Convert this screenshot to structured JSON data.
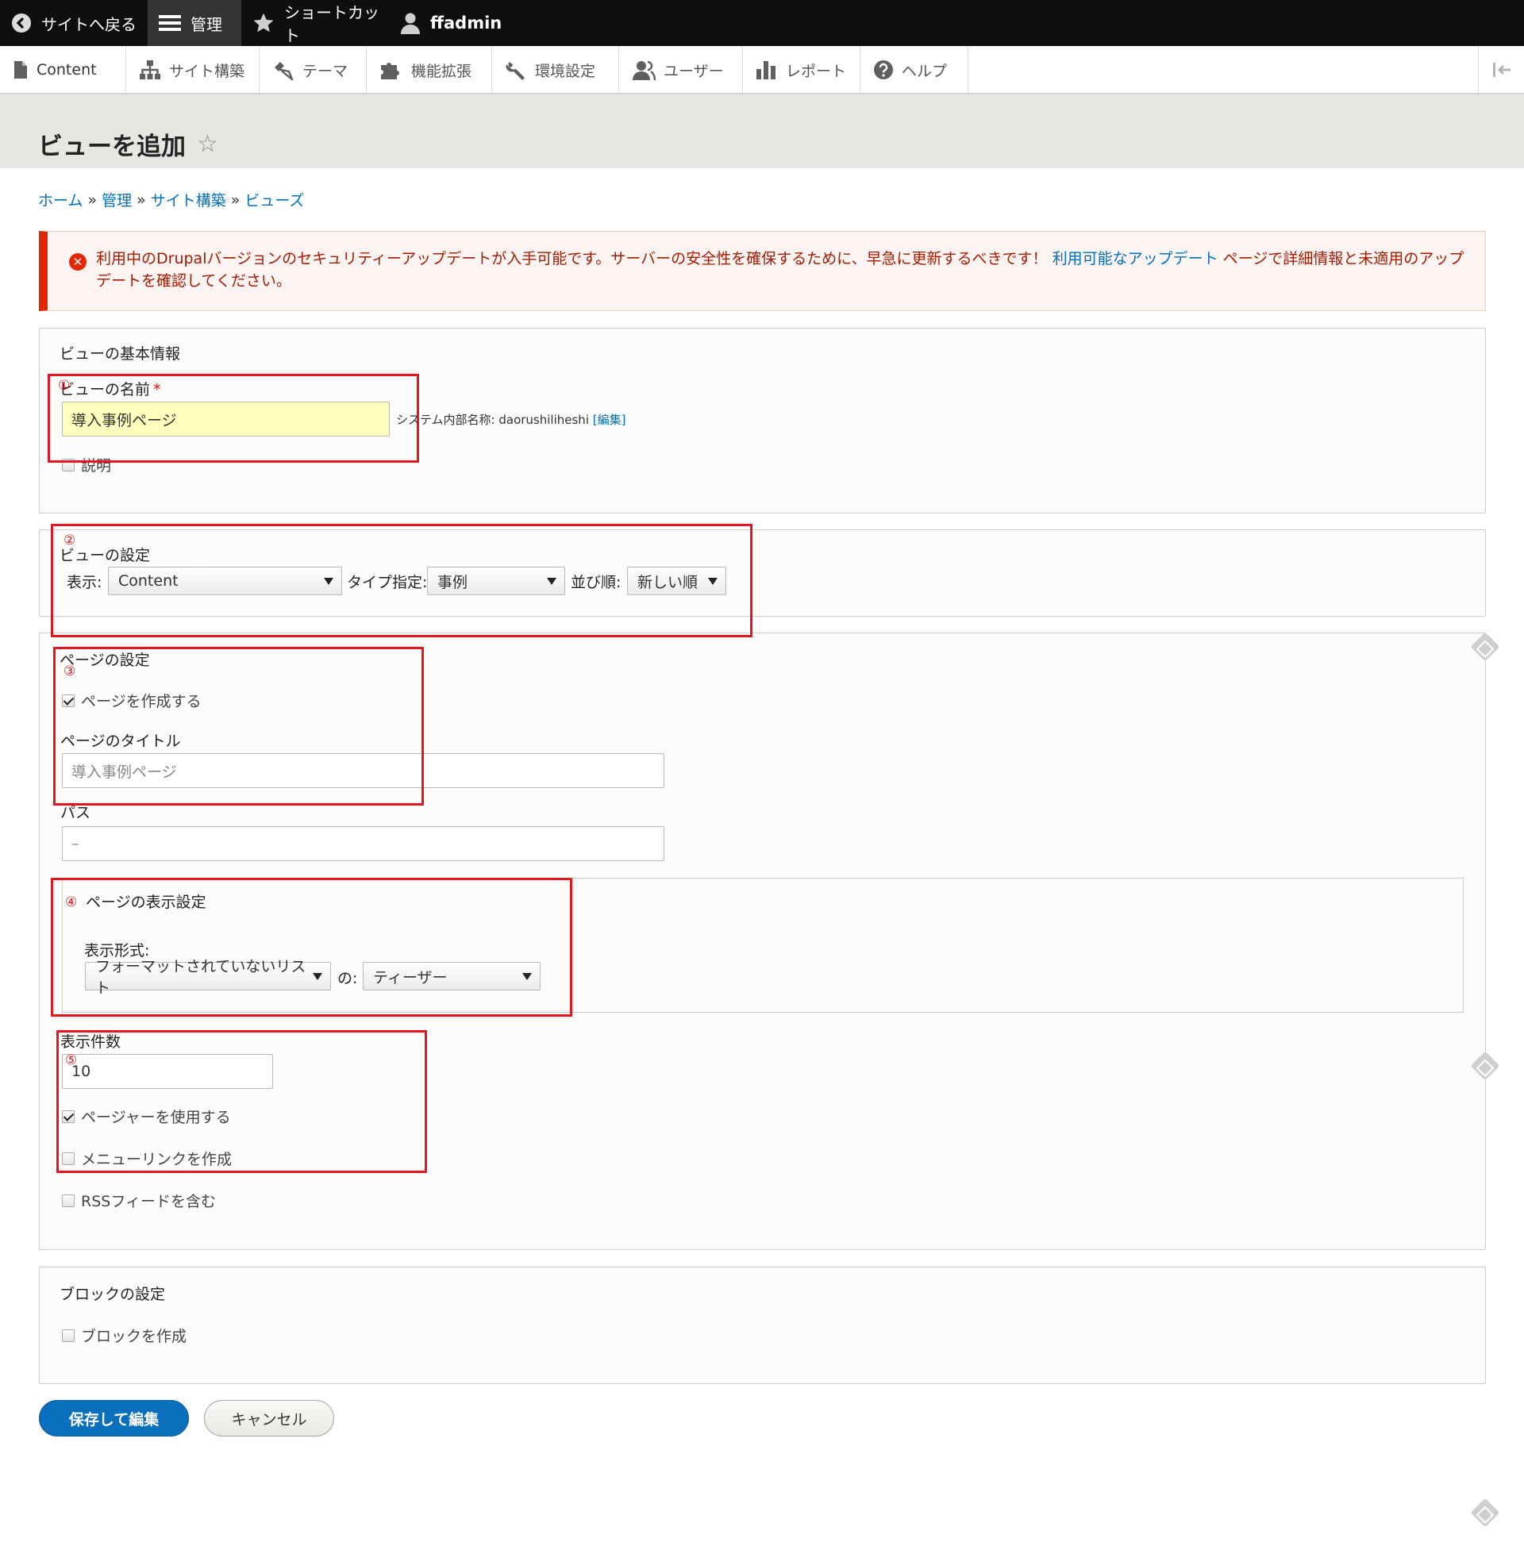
{
  "toolbar": {
    "back_label": "サイトへ戻る",
    "manage_label": "管理",
    "shortcut_label": "ショートカット",
    "user_label": "ffadmin"
  },
  "tray": {
    "items": [
      {
        "label": "Content",
        "icon": "file-icon"
      },
      {
        "label": "サイト構築",
        "icon": "sitemap-icon"
      },
      {
        "label": "テーマ",
        "icon": "paintbrush-icon"
      },
      {
        "label": "機能拡張",
        "icon": "puzzle-icon"
      },
      {
        "label": "環境設定",
        "icon": "wrench-icon"
      },
      {
        "label": "ユーザー",
        "icon": "people-icon"
      },
      {
        "label": "レポート",
        "icon": "bar-chart-icon"
      },
      {
        "label": "ヘルプ",
        "icon": "help-icon"
      }
    ]
  },
  "page": {
    "title": "ビューを追加"
  },
  "breadcrumb": {
    "items": [
      "ホーム",
      "管理",
      "サイト構築",
      "ビューズ"
    ],
    "separator": "»"
  },
  "alert": {
    "text_before": "利用中のDrupalバージョンのセキュリティーアップデートが入手可能です。サーバーの安全性を確保するために、早急に更新するべきです！",
    "link": "利用可能なアップデート",
    "text_after": "ページで詳細情報と未適用のアップデートを確認してください。"
  },
  "basic": {
    "legend": "ビューの基本情報",
    "name_label": "ビューの名前",
    "required_mark": "*",
    "name_value": "導入事例ページ",
    "machine_prefix": "システム内部名称: daorushiliheshi",
    "machine_edit": "[編集]",
    "description_label": "説明"
  },
  "view_settings": {
    "legend": "ビューの設定",
    "show_label": "表示:",
    "show_value": "Content",
    "type_label": "タイプ指定:",
    "type_value": "事例",
    "sort_label": "並び順:",
    "sort_value": "新しい順"
  },
  "page_settings": {
    "legend": "ページの設定",
    "create_page_label": "ページを作成する",
    "create_page_checked": true,
    "title_label": "ページのタイトル",
    "title_value": "導入事例ページ",
    "path_label": "パス",
    "path_value": "–",
    "display_legend": "ページの表示設定",
    "format_label": "表示形式:",
    "format_value": "フォーマットされていないリスト",
    "of_label": "の:",
    "of_value": "ティーザー",
    "items_label": "表示件数",
    "items_value": "10",
    "pager_label": "ページャーを使用する",
    "pager_checked": true,
    "menu_label": "メニューリンクを作成",
    "menu_checked": false,
    "rss_label": "RSSフィードを含む",
    "rss_checked": false
  },
  "block_settings": {
    "legend": "ブロックの設定",
    "create_block_label": "ブロックを作成",
    "create_block_checked": false
  },
  "actions": {
    "save_label": "保存して編集",
    "cancel_label": "キャンセル"
  },
  "annotations": [
    "①",
    "②",
    "③",
    "④",
    "⑤"
  ],
  "colors": {
    "annotation": "#e3161f",
    "link": "#0071b8",
    "primary": "#0a6fbd",
    "error": "#e32700"
  }
}
